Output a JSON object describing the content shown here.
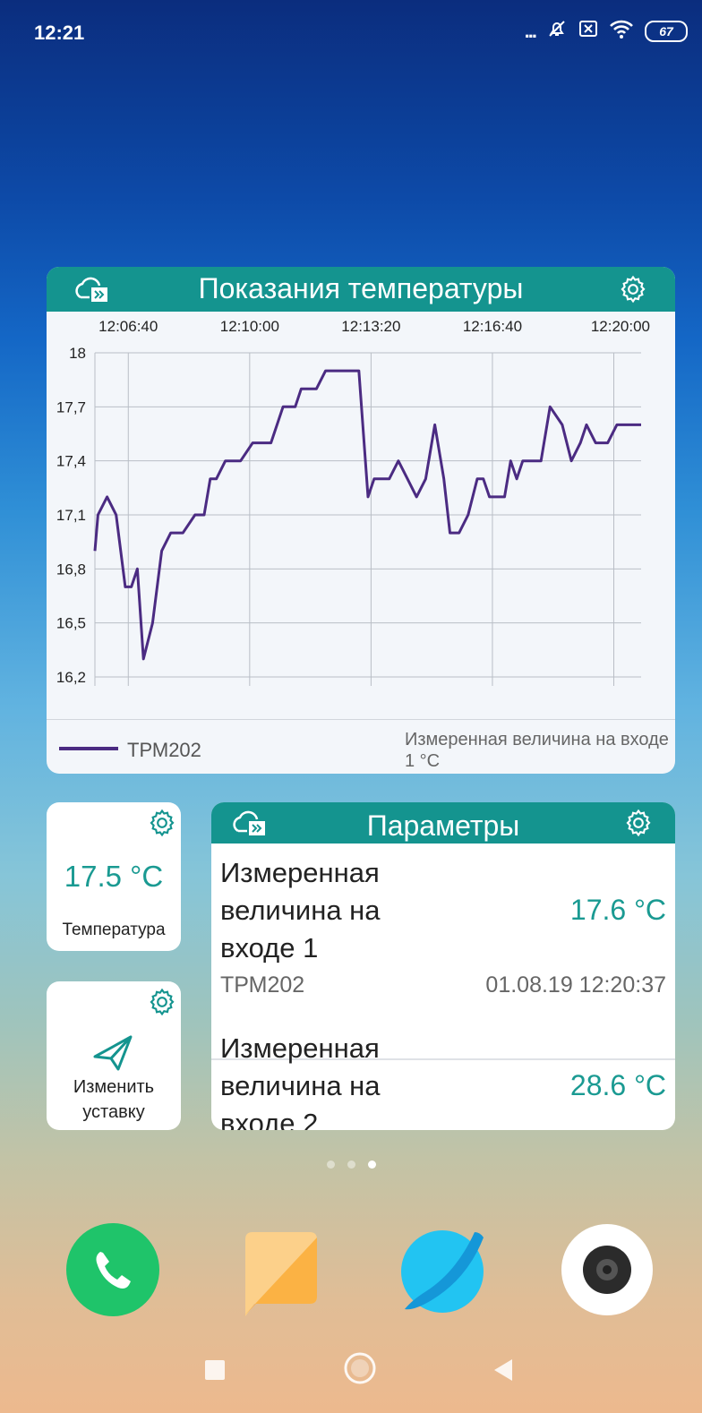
{
  "status_bar": {
    "time": "12:21",
    "icons": [
      "more-dots-icon",
      "bell-off-icon",
      "sim-x-icon",
      "wifi-icon",
      "battery-icon"
    ],
    "more_glyph": "...",
    "battery": "67"
  },
  "chart_widget": {
    "title": "Показания температуры",
    "legend_series": "ТРМ202",
    "legend_desc": "Измеренная величина на входе 1 °C"
  },
  "chart_data": {
    "type": "line",
    "title": "Показания температуры",
    "x_tick_labels": [
      "12:06:40",
      "12:10:00",
      "12:13:20",
      "12:16:40",
      "12:20:00"
    ],
    "x_start": "12:05:45",
    "x_end": "12:20:45",
    "y_tick_labels": [
      "18",
      "17,7",
      "17,4",
      "17,1",
      "16,8",
      "16,5",
      "16,2"
    ],
    "ylim": [
      16.2,
      18.0
    ],
    "grid": true,
    "legend_position": "bottom-left",
    "series": [
      {
        "name": "ТРМ202",
        "color": "#4b2b82",
        "times": [
          "12:05:45",
          "12:05:50",
          "12:06:05",
          "12:06:20",
          "12:06:35",
          "12:06:45",
          "12:06:55",
          "12:07:05",
          "12:07:20",
          "12:07:35",
          "12:07:50",
          "12:08:00",
          "12:08:10",
          "12:08:30",
          "12:08:45",
          "12:08:55",
          "12:09:05",
          "12:09:20",
          "12:09:35",
          "12:09:45",
          "12:10:05",
          "12:10:20",
          "12:10:35",
          "12:10:55",
          "12:11:10",
          "12:11:15",
          "12:11:25",
          "12:11:40",
          "12:11:50",
          "12:12:05",
          "12:12:20",
          "12:12:35",
          "12:13:00",
          "12:13:15",
          "12:13:25",
          "12:13:35",
          "12:13:50",
          "12:14:05",
          "12:14:20",
          "12:14:35",
          "12:14:50",
          "12:15:05",
          "12:15:20",
          "12:15:30",
          "12:15:45",
          "12:16:00",
          "12:16:15",
          "12:16:25",
          "12:16:35",
          "12:16:45",
          "12:17:00",
          "12:17:10",
          "12:17:20",
          "12:17:30",
          "12:17:35",
          "12:17:45",
          "12:18:00",
          "12:18:15",
          "12:18:35",
          "12:18:50",
          "12:19:05",
          "12:19:15",
          "12:19:30",
          "12:19:40",
          "12:19:50",
          "12:20:05",
          "12:20:20",
          "12:20:35",
          "12:20:45"
        ],
        "values": [
          16.9,
          17.1,
          17.2,
          17.1,
          16.7,
          16.7,
          16.8,
          16.3,
          16.5,
          16.9,
          17.0,
          17.0,
          17.0,
          17.1,
          17.1,
          17.3,
          17.3,
          17.4,
          17.4,
          17.4,
          17.5,
          17.5,
          17.5,
          17.7,
          17.7,
          17.7,
          17.8,
          17.8,
          17.8,
          17.9,
          17.9,
          17.9,
          17.9,
          17.2,
          17.3,
          17.3,
          17.3,
          17.4,
          17.3,
          17.2,
          17.3,
          17.6,
          17.3,
          17.0,
          17.0,
          17.1,
          17.3,
          17.3,
          17.2,
          17.2,
          17.2,
          17.4,
          17.3,
          17.4,
          17.4,
          17.4,
          17.4,
          17.7,
          17.6,
          17.4,
          17.5,
          17.6,
          17.5,
          17.5,
          17.5,
          17.6,
          17.6,
          17.6,
          17.6
        ]
      }
    ]
  },
  "temp_widget": {
    "value": "17.5 °C",
    "label": "Температура"
  },
  "setpoint_widget": {
    "label_line1": "Изменить",
    "label_line2": "уставку"
  },
  "params_widget": {
    "title": "Параметры",
    "rows": [
      {
        "name_line1": "Измеренная",
        "name_line2": "величина на",
        "name_line3": "входе 1",
        "value": "17.6 °C",
        "device": "ТРМ202",
        "timestamp": "01.08.19 12:20:37"
      },
      {
        "name_line1": "Измеренная",
        "name_line2": "величина на",
        "name_line3": "входе 2",
        "value": "28.6 °C"
      }
    ]
  },
  "page_indicator": {
    "count": 3,
    "active_index": 2
  },
  "dock": [
    "phone-icon",
    "messages-icon",
    "browser-icon",
    "camera-icon"
  ],
  "nav_bar": [
    "recents-button",
    "home-button",
    "back-button"
  ],
  "colors": {
    "accent": "#14948f",
    "value_text": "#1a9a92",
    "series": "#4b2b82"
  }
}
